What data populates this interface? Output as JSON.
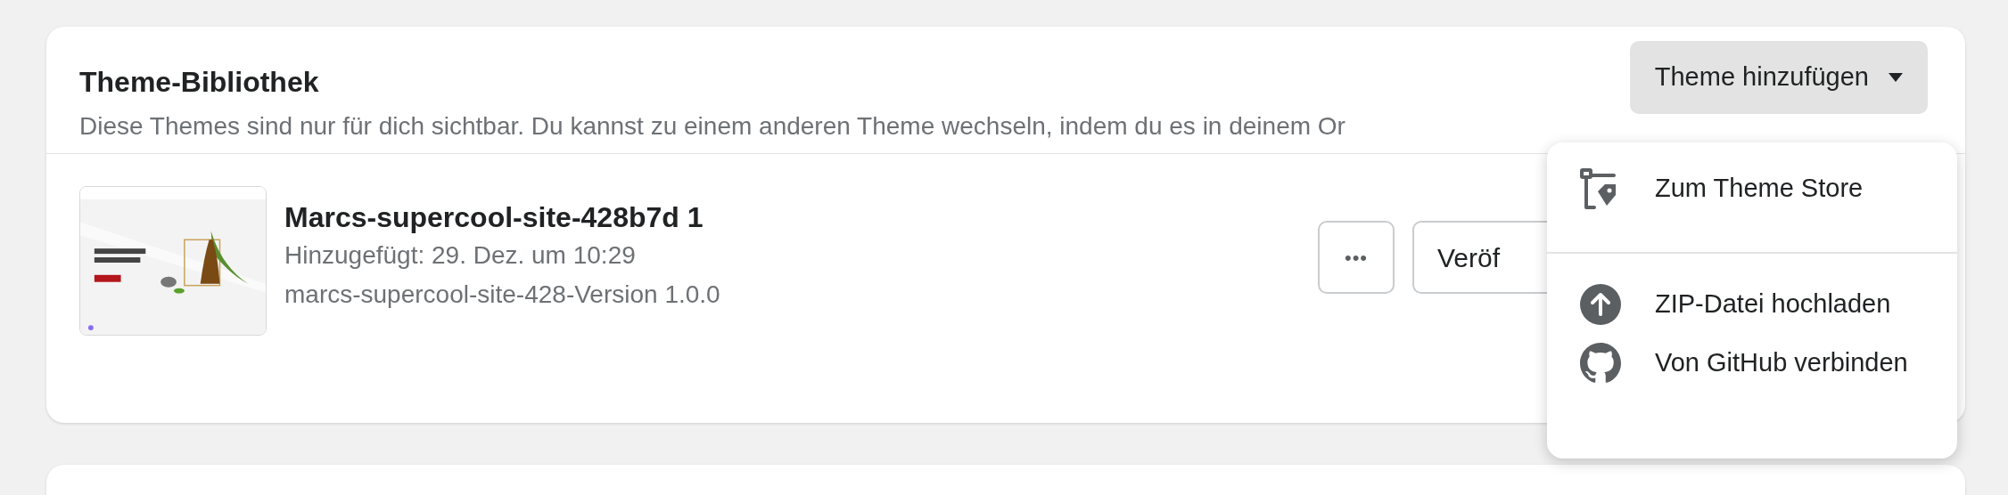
{
  "library": {
    "title": "Theme-Bibliothek",
    "description": "Diese Themes sind nur für dich sichtbar. Du kannst zu einem anderen Theme wechseln, indem du es in deinem Or",
    "add_button": {
      "label": "Theme hinzufügen",
      "expanded": true
    }
  },
  "themes": [
    {
      "name": "Marcs-supercool-site-428b7d 1",
      "added": "Hinzugefügt: 29. Dez. um 10:29",
      "version": "marcs-supercool-site-428-Version 1.0.0",
      "more_button": "•••",
      "publish_button": "Veröf"
    }
  ],
  "menu": {
    "sections": [
      {
        "items": [
          {
            "kind": "store",
            "label": "Zum Theme Store"
          }
        ]
      },
      {
        "items": [
          {
            "kind": "upload",
            "label": "ZIP-Datei hochladen"
          },
          {
            "kind": "github",
            "label": "Von GitHub verbinden"
          }
        ]
      }
    ]
  }
}
